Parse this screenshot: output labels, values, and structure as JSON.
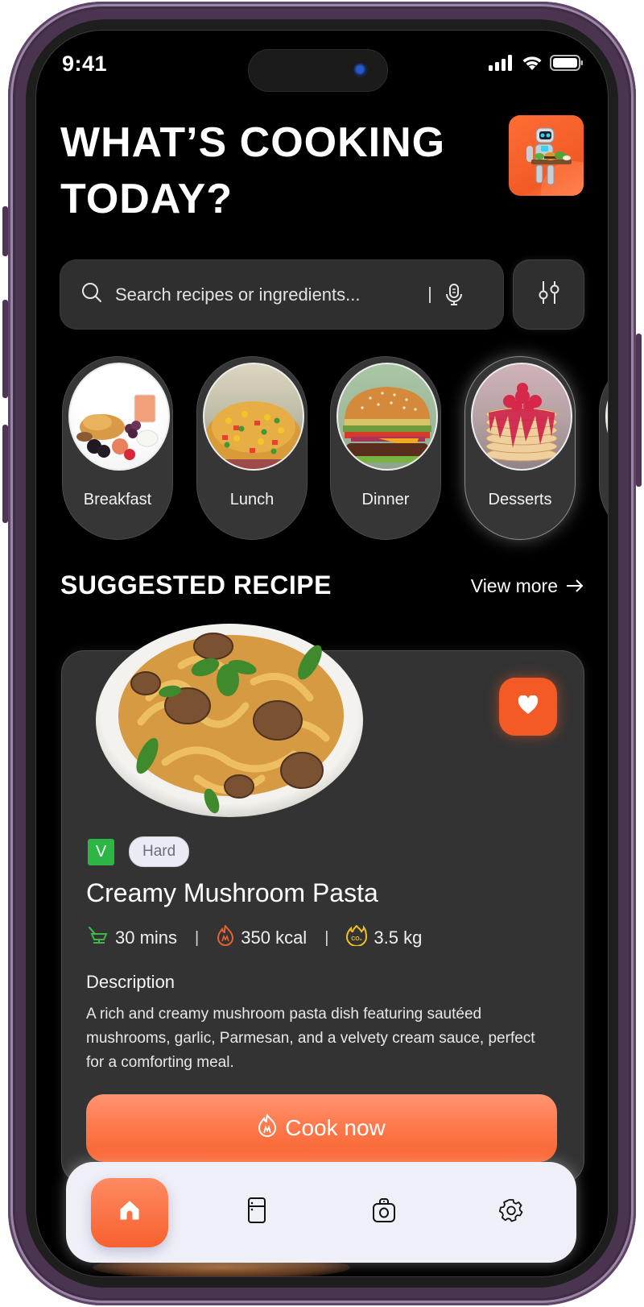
{
  "status_bar": {
    "time": "9:41",
    "icons": [
      "cellular-signal-icon",
      "wifi-icon",
      "battery-icon"
    ]
  },
  "header": {
    "title": "WHAT’S COOKING TODAY?",
    "avatar_alt": "Robot chef carrying tray of food"
  },
  "search": {
    "placeholder": "Search recipes or ingredients...",
    "value": "",
    "icons": {
      "search": "search-icon",
      "voice": "microphone-icon",
      "filter": "sliders-icon"
    }
  },
  "categories": [
    {
      "label": "Breakfast",
      "image": "breakfast-plate",
      "selected": false
    },
    {
      "label": "Lunch",
      "image": "fried-rice",
      "selected": false
    },
    {
      "label": "Dinner",
      "image": "burger",
      "selected": false
    },
    {
      "label": "Desserts",
      "image": "pancake-stack",
      "selected": true
    }
  ],
  "suggested": {
    "section_title": "SUGGESTED RECIPE",
    "view_more": "View more",
    "recipe": {
      "name": "Creamy Mushroom Pasta",
      "veg_badge": "V",
      "difficulty": "Hard",
      "favorited": true,
      "stats": [
        {
          "icon": "cooking-pot-icon",
          "value": "30 mins",
          "color": "#3fb54a"
        },
        {
          "icon": "flame-icon",
          "value": "350 kcal",
          "color": "#e8612f"
        },
        {
          "icon": "co2-icon",
          "value": "3.5 kg",
          "color": "#f2c21c"
        }
      ],
      "description_label": "Description",
      "description": "A rich and creamy mushroom pasta dish featuring sautéed mushrooms, garlic, Parmesan, and a velvety cream sauce, perfect for a comforting meal.",
      "cta": "Cook now"
    }
  },
  "bottom_nav": {
    "items": [
      {
        "name": "home",
        "icon": "home-icon",
        "active": true
      },
      {
        "name": "fridge",
        "icon": "fridge-icon",
        "active": false
      },
      {
        "name": "camera",
        "icon": "camera-icon",
        "active": false
      },
      {
        "name": "settings",
        "icon": "gear-icon",
        "active": false
      }
    ]
  },
  "colors": {
    "accent": "#f35a25",
    "background": "#000000",
    "card": "#333333",
    "veg_green": "#2db644",
    "nav_bg": "#efeff7",
    "frame": "#4a3450"
  }
}
